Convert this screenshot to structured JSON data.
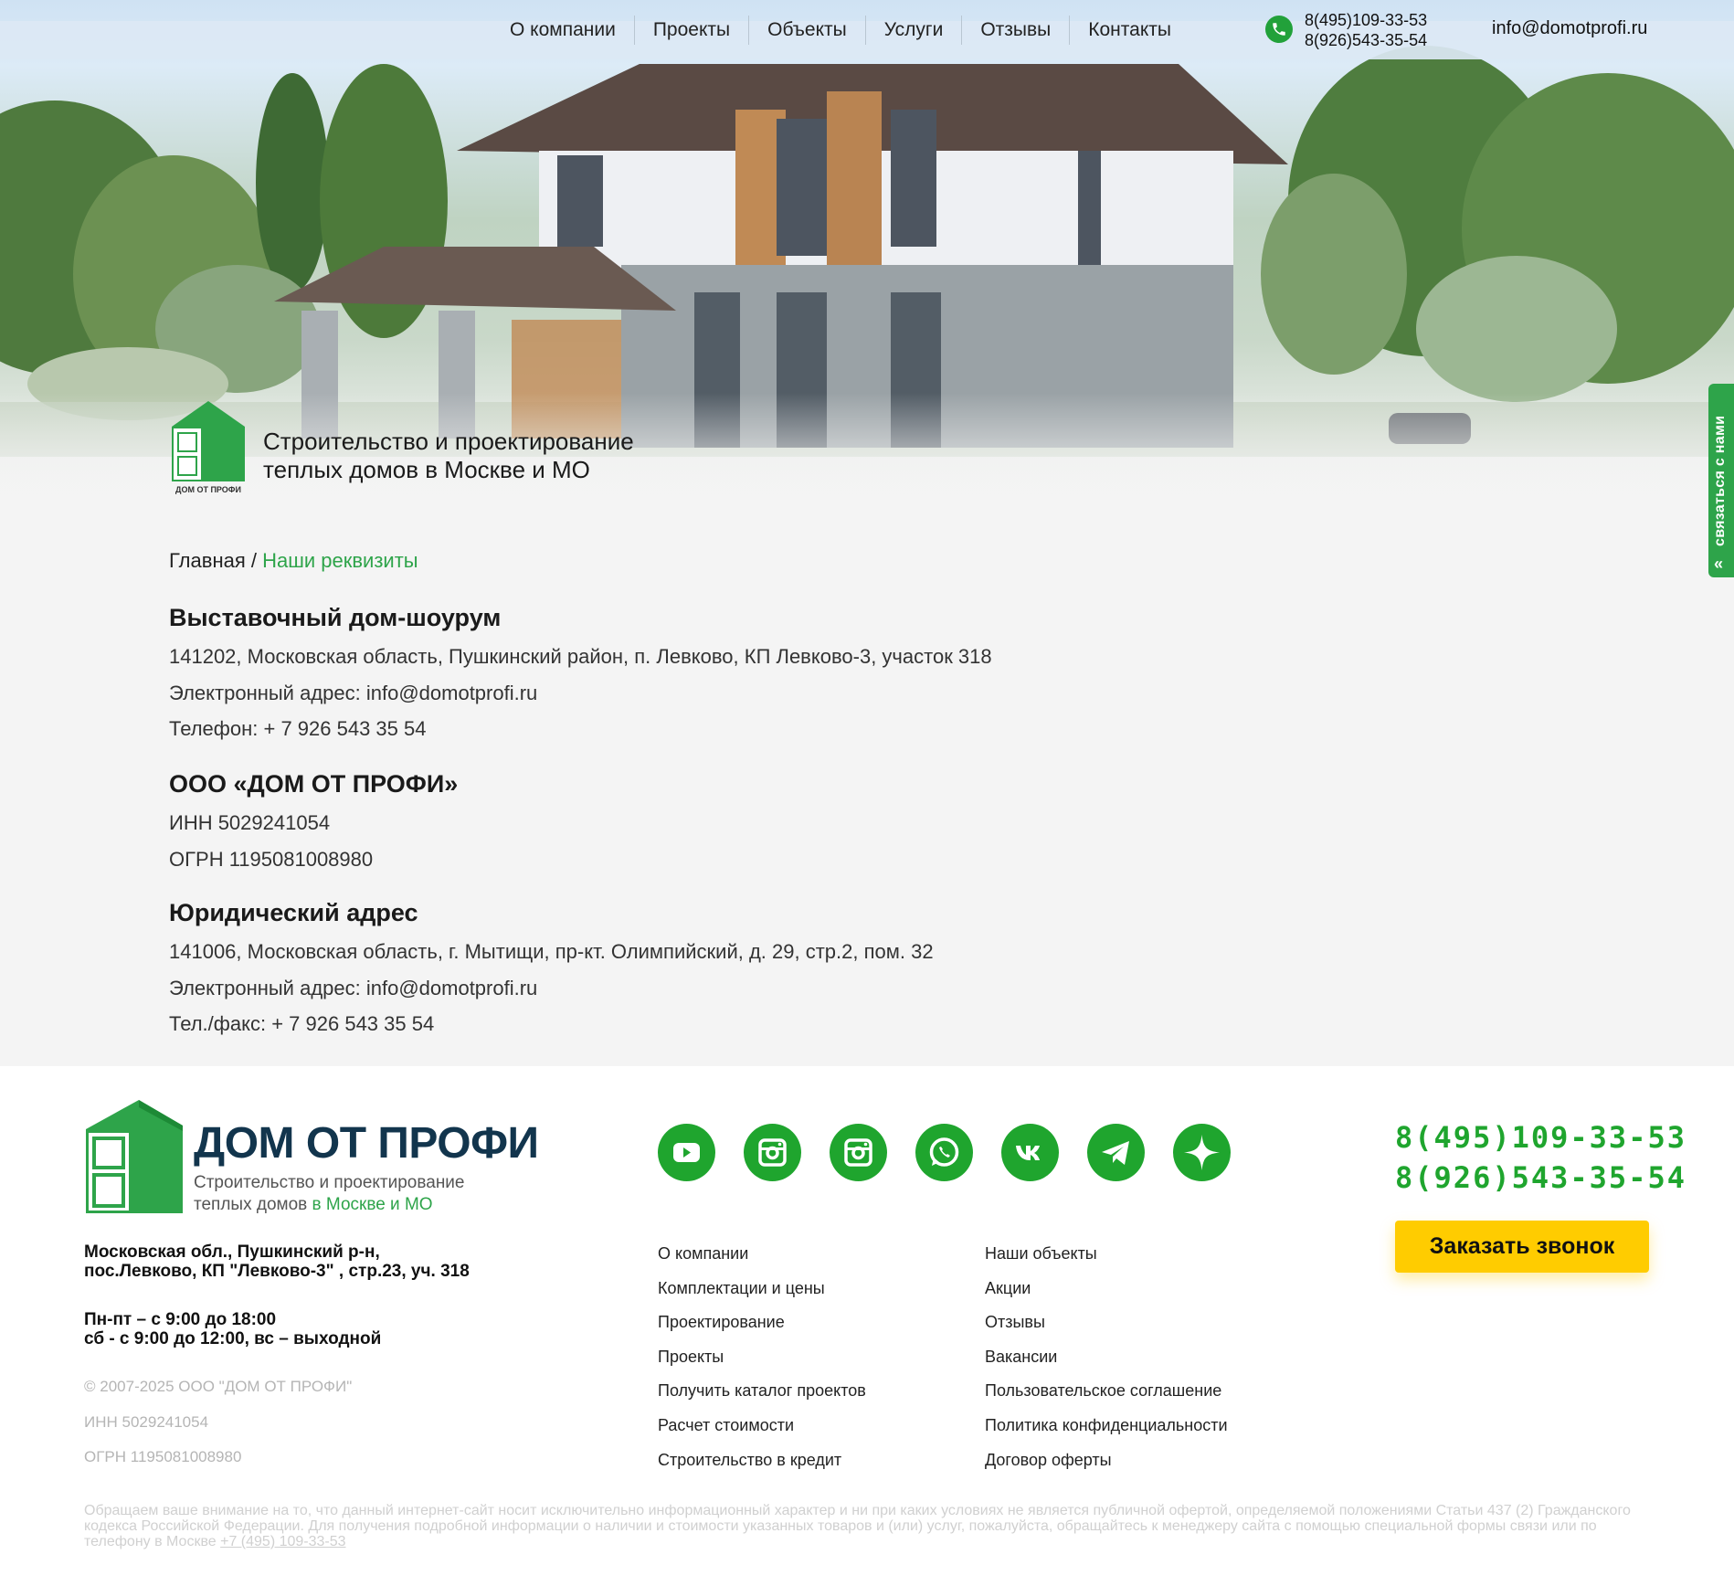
{
  "stray_text": ")}",
  "nav": {
    "items": [
      "О компании",
      "Проекты",
      "Объекты",
      "Услуги",
      "Отзывы",
      "Контакты"
    ]
  },
  "header": {
    "phone1": "8(495)109-33-53",
    "phone2": "8(926)543-35-54",
    "email": "info@domotprofi.ru"
  },
  "hero": {
    "logo_caption": "ДОМ ОТ ПРОФИ",
    "tagline_line1": "Строительство и проектирование",
    "tagline_line2": "теплых домов в Москве и МО"
  },
  "side_tab": {
    "label": "связаться с нами",
    "chevron": "«"
  },
  "breadcrumb": {
    "home": "Главная",
    "separator": " / ",
    "current": "Наши реквизиты"
  },
  "sections": {
    "showroom": {
      "title": "Выставочный дом-шоурум",
      "address": "141202, Московская область, Пушкинский район, п. Левково, КП Левково-3, участок 318",
      "email": "Электронный адрес: info@domotprofi.ru",
      "phone": "Телефон: + 7 926 543 35 54"
    },
    "company": {
      "title": "ООО «ДОМ ОТ ПРОФИ»",
      "inn": "ИНН 5029241054",
      "ogrn": "ОГРН 1195081008980"
    },
    "legal": {
      "title": "Юридический адрес",
      "address": "141006, Московская область, г. Мытищи, пр-кт. Олимпийский, д. 29, стр.2, пом. 32",
      "email": "Электронный адрес: info@domotprofi.ru",
      "phone": "Тел./факс: + 7 926 543 35 54"
    }
  },
  "footer": {
    "brand": "ДОМ ОТ ПРОФИ",
    "sub_line1": "Строительство и проектирование",
    "sub_line2_a": "теплых домов ",
    "sub_line2_b": "в Москве и МО",
    "address_line1": "Московская обл., Пушкинский р-н,",
    "address_line2": "пос.Левково, КП \"Левково-3\" , стр.23, уч. 318",
    "hours_line1": "Пн-пт – с 9:00 до 18:00",
    "hours_line2": "сб - с 9:00 до 12:00, вс – выходной",
    "copyright": "© 2007-2025 ООО \"ДОМ ОТ ПРОФИ\"",
    "inn": "ИНН 5029241054",
    "ogrn": "ОГРН 1195081008980",
    "socials": [
      "youtube-icon",
      "instagram-icon",
      "instagram-icon",
      "whatsapp-icon",
      "vk-icon",
      "telegram-icon",
      "zen-icon"
    ],
    "menu_col1": [
      "О компании",
      "Комплектации и цены",
      "Проектирование",
      "Проекты",
      "Получить каталог проектов",
      "Расчет стоимости",
      "Строительство в кредит"
    ],
    "menu_col2": [
      "Наши объекты",
      "Акции",
      "Отзывы",
      "Вакансии",
      "Пользовательское соглашение",
      "Политика конфиденциальности",
      "Договор оферты"
    ],
    "phone1": "8(495)109-33-53",
    "phone2": "8(926)543-35-54",
    "callback_label": "Заказать звонок",
    "disclaimer": "Обращаем ваше внимание на то, что данный интернет-сайт носит исключительно информационный характер и ни при каких условиях не является публичной офертой, определяемой положениями Статьи 437 (2) Гражданского кодекса Российской Федерации. Для получения подробной информации о наличии и стоимости указанных товаров и (или) услуг, пожалуйста, обращайтесь к менеджеру сайта с помощью специальной формы связи или по телефону в Москве ",
    "disclaimer_phone": "+7 (495) 109-33-53"
  },
  "colors": {
    "accent_green": "#1fa52e",
    "brand_navy": "#12354d",
    "callback_yellow": "#ffcc00"
  }
}
